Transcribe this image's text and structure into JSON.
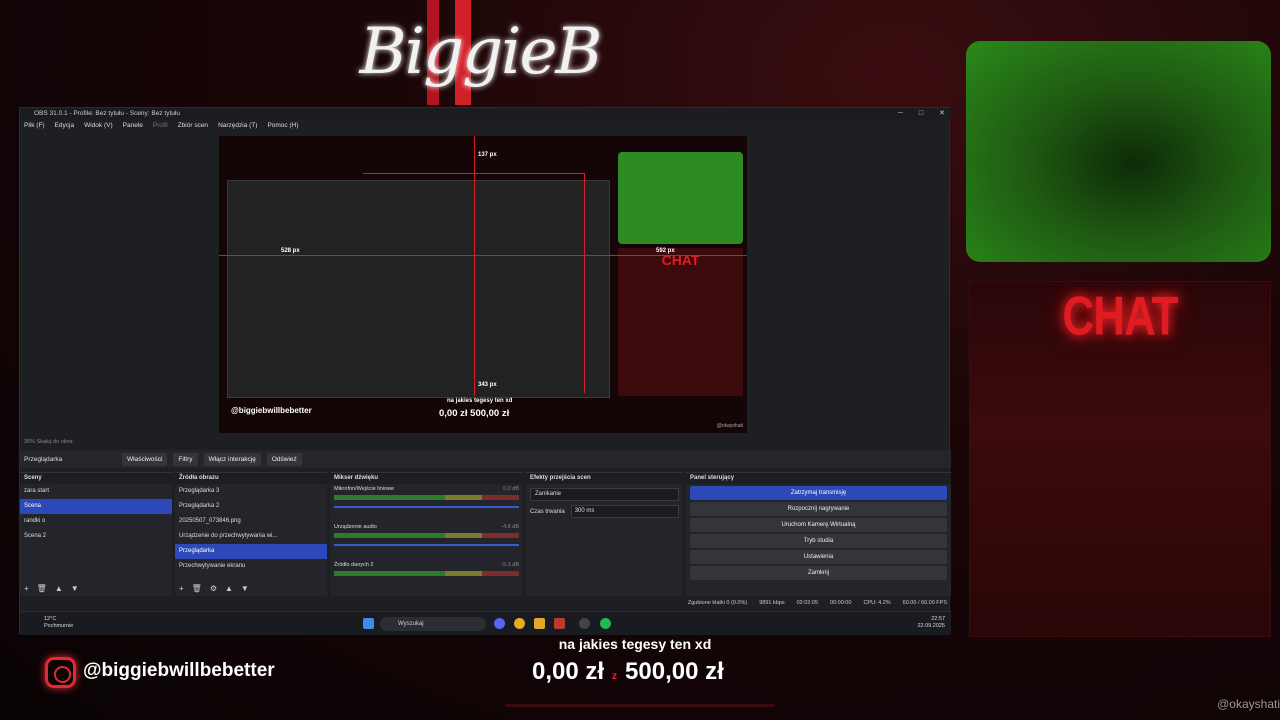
{
  "overlay": {
    "logo_text": "BiggieB",
    "goal_title": "na jakies tegesy ten xd",
    "goal_current": "0,00 zł",
    "goal_sep": "z",
    "goal_target": "500,00 zł",
    "instagram_handle": "@biggiebwillbebetter",
    "watermark": "@okayshati",
    "accent_color": "#e02a36"
  },
  "chat": {
    "title": "CHAT"
  },
  "obs": {
    "title": "OBS 31.0.1 - Profile: Bez tytułu - Sceny: Bez tytułu",
    "window_controls": [
      "─",
      "□",
      "✕"
    ],
    "menu": [
      {
        "label": "Plik (F)"
      },
      {
        "label": "Edycja"
      },
      {
        "label": "Widok (V)"
      },
      {
        "label": "Panele"
      },
      {
        "label": "Profil"
      },
      {
        "label": "Zbiór scen"
      },
      {
        "label": "Narzędzia (T)"
      },
      {
        "label": "Pomoc (H)"
      }
    ],
    "preview": {
      "px_labels": [
        "137 px",
        "528 px",
        "592 px",
        "343 px"
      ],
      "handle": "@biggiebwillbebetter",
      "goal_title": "na jakies tegesy ten xd",
      "goal": "0,00 zł  500,00 zł",
      "watermark": "@okayshati",
      "chat": "CHAT"
    },
    "scale": "36%  Skaluj do okna",
    "source_bar": {
      "source_name": "Przeglądarka",
      "buttons": [
        "Właściwości",
        "Filtry",
        "Włącz interakcję",
        "Odśwież"
      ]
    },
    "scenes": {
      "header": "Sceny",
      "items": [
        "zara start",
        "Scena",
        "randki o",
        "Scena 2"
      ],
      "selected_index": 1
    },
    "sources": {
      "header": "Źródła obrazu",
      "items": [
        "Przeglądarka 3",
        "Przeglądarka 2",
        "20250507_073846.png",
        "Urządzenie do przechwytywania wi...",
        "Przeglądarka",
        "Przechwytywanie ekranu"
      ],
      "selected_index": 4
    },
    "mixer": {
      "header": "Mikser dźwięku",
      "channels": [
        {
          "name": "Mikrofon/Wejście liniowe",
          "db": "0.0 dB"
        },
        {
          "name": "Urządzenie audio",
          "db": "-4.8 dB"
        },
        {
          "name": "Źródło danych 2",
          "db": "-5.3 dB"
        }
      ]
    },
    "transitions": {
      "header": "Efekty przejścia scen",
      "selected": "Zanikanie",
      "duration_label": "Czas trwania",
      "duration_value": "300 ms"
    },
    "controls": {
      "header": "Panel sterujący",
      "buttons": [
        "Zatrzymaj transmisję",
        "Rozpocznij nagrywanie",
        "Uruchom Kamerę Wirtualną",
        "Tryb studia",
        "Ustawienia",
        "Zamknij"
      ]
    },
    "status": {
      "dropped": "Zgubione klatki 0 (0.0%)",
      "bitrate": "9891 kbps",
      "stream_time": "02:02:05",
      "rec_time": "00:00:00",
      "cpu": "CPU: 4.2%",
      "fps": "60.00 / 60.00 FPS"
    },
    "taskbar": {
      "weather_temp": "12°C",
      "weather_desc": "Pochmurnie",
      "search_placeholder": "Wyszukaj",
      "time": "22:57",
      "date": "22.09.2025"
    }
  }
}
